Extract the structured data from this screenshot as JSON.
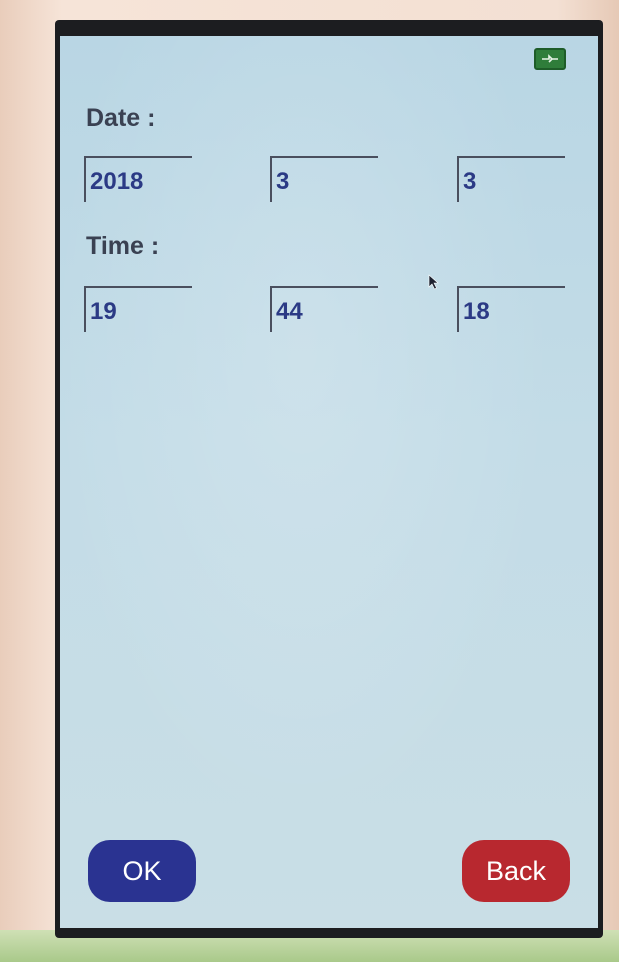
{
  "status": {
    "battery_icon": "battery-charging-icon",
    "battery_color": "#2f7d3a"
  },
  "date": {
    "label": "Date :",
    "year": "2018",
    "month": "3",
    "day": "3"
  },
  "time": {
    "label": "Time :",
    "hour": "19",
    "minute": "44",
    "second": "18"
  },
  "buttons": {
    "ok_label": "OK",
    "ok_color": "#2a3391",
    "back_label": "Back",
    "back_color": "#b8282f"
  }
}
